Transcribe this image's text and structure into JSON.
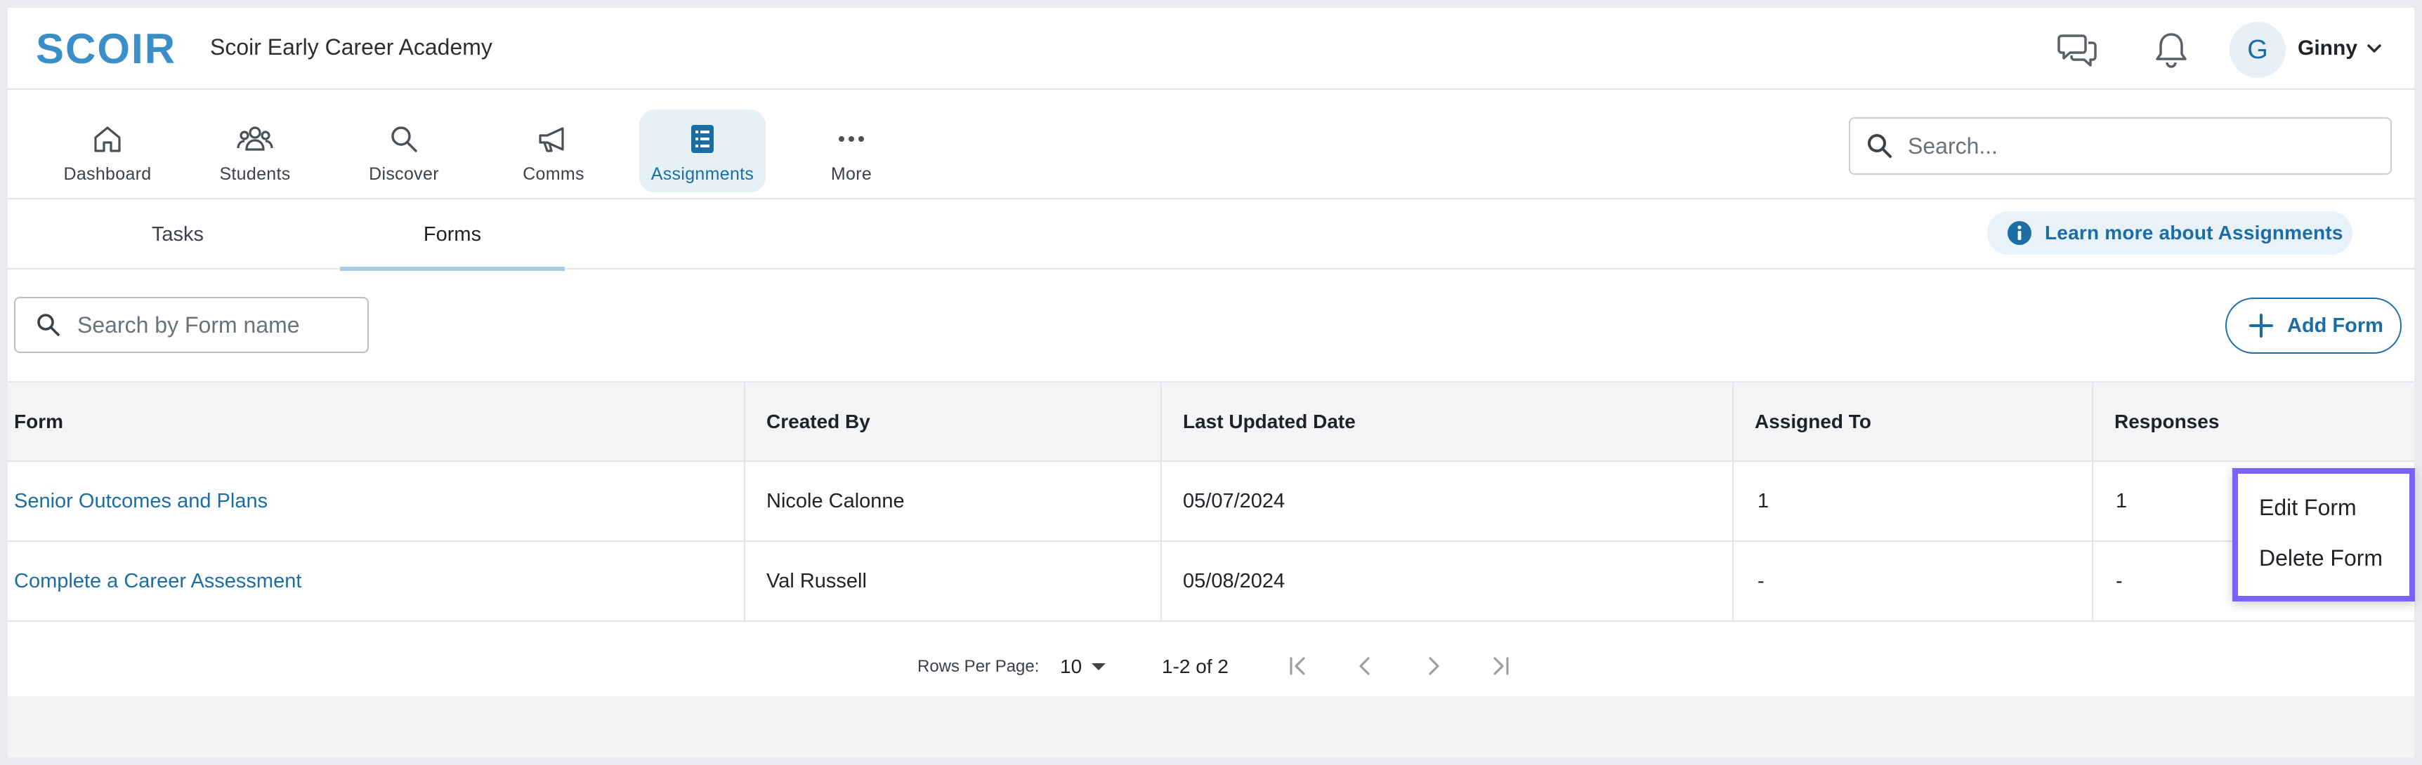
{
  "header": {
    "logo_text": "SCOIR",
    "org_name": "Scoir Early Career Academy",
    "user": {
      "initial": "G",
      "name": "Ginny"
    }
  },
  "nav": {
    "items": [
      {
        "label": "Dashboard",
        "icon": "home-icon"
      },
      {
        "label": "Students",
        "icon": "students-icon"
      },
      {
        "label": "Discover",
        "icon": "search-icon"
      },
      {
        "label": "Comms",
        "icon": "megaphone-icon"
      },
      {
        "label": "Assignments",
        "icon": "assignments-icon",
        "active": true
      },
      {
        "label": "More",
        "icon": "more-icon"
      }
    ],
    "search_placeholder": "Search..."
  },
  "tabs": {
    "items": [
      {
        "label": "Tasks"
      },
      {
        "label": "Forms",
        "active": true
      }
    ],
    "learn_more": "Learn more about Assignments"
  },
  "toolbar": {
    "search_placeholder": "Search by Form name",
    "add_form_label": "Add Form"
  },
  "table": {
    "columns": [
      "Form",
      "Created By",
      "Last Updated Date",
      "Assigned To",
      "Responses"
    ],
    "rows": [
      {
        "form": "Senior Outcomes and Plans",
        "created_by": "Nicole Calonne",
        "updated": "05/07/2024",
        "assigned": "1",
        "responses": "1"
      },
      {
        "form": "Complete a Career Assessment",
        "created_by": "Val Russell",
        "updated": "05/08/2024",
        "assigned": "-",
        "responses": "-"
      }
    ]
  },
  "context_menu": {
    "items": [
      "Edit Form",
      "Delete Form"
    ]
  },
  "pagination": {
    "rows_per_page_label": "Rows Per Page:",
    "rows_per_page": "10",
    "range": "1-2 of 2"
  },
  "colors": {
    "brand": "#1b6ea5",
    "logo": "#3a8fc8",
    "menu_highlight": "#7b61ff"
  }
}
